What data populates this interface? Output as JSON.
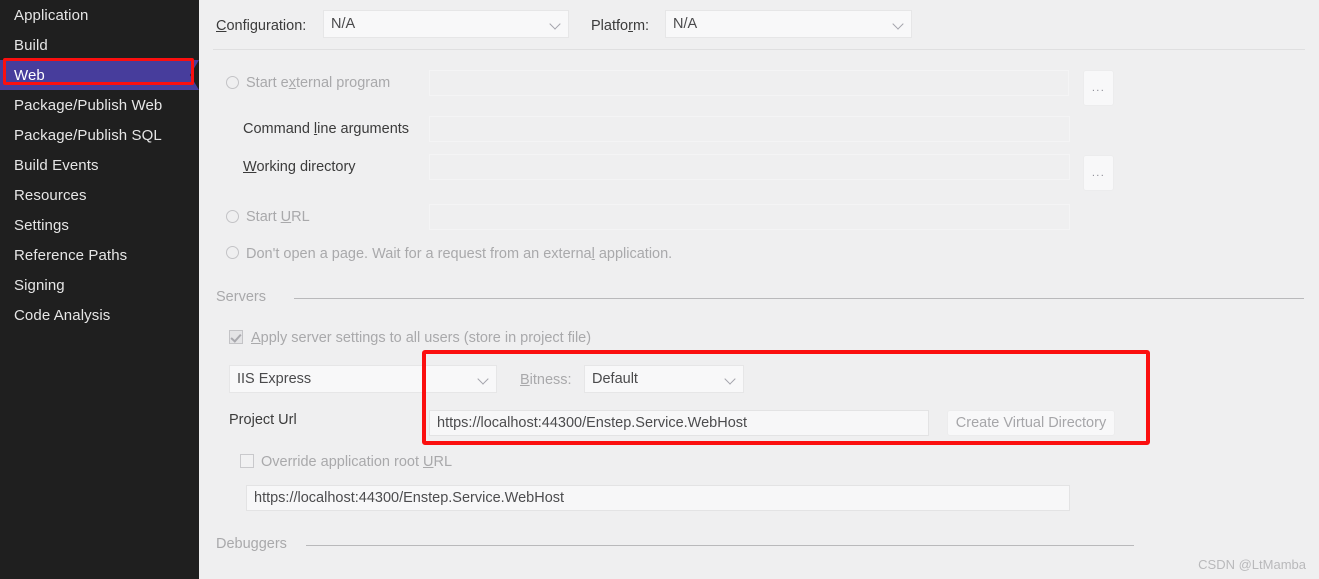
{
  "sidebar": {
    "items": [
      {
        "label": "Application",
        "selected": false
      },
      {
        "label": "Build",
        "selected": false
      },
      {
        "label": "Web",
        "selected": true
      },
      {
        "label": "Package/Publish Web",
        "selected": false
      },
      {
        "label": "Package/Publish SQL",
        "selected": false
      },
      {
        "label": "Build Events",
        "selected": false
      },
      {
        "label": "Resources",
        "selected": false
      },
      {
        "label": "Settings",
        "selected": false
      },
      {
        "label": "Reference Paths",
        "selected": false
      },
      {
        "label": "Signing",
        "selected": false
      },
      {
        "label": "Code Analysis",
        "selected": false
      }
    ]
  },
  "toolbar": {
    "configuration_label": "Configuration:",
    "configuration_value": "N/A",
    "platform_label": "Platform:",
    "platform_value": "N/A"
  },
  "start_action": {
    "start_external_program_label": "Start external program",
    "start_external_program_value": "",
    "command_line_arguments_label": "Command line arguments",
    "command_line_arguments_value": "",
    "working_directory_label": "Working directory",
    "working_directory_value": "",
    "start_url_label": "Start URL",
    "start_url_value": "",
    "dont_open_page_label": "Don't open a page. Wait for a request from an external application.",
    "browse_button_label": "..."
  },
  "servers": {
    "group_title": "Servers",
    "apply_server_settings_label": "Apply server settings to all users (store in project file)",
    "apply_server_settings_checked": true,
    "server_value": "IIS Express",
    "bitness_label": "Bitness:",
    "bitness_value": "Default",
    "project_url_label": "Project Url",
    "project_url_value": "https://localhost:44300/Enstep.Service.WebHost",
    "create_virtual_directory_label": "Create Virtual Directory",
    "override_root_url_label": "Override application root URL",
    "override_root_url_checked": false,
    "override_root_url_value": "https://localhost:44300/Enstep.Service.WebHost"
  },
  "debuggers": {
    "group_title": "Debuggers"
  },
  "watermark": "CSDN @LtMamba",
  "colors": {
    "sidebar_bg": "#1f1f1f",
    "selection": "#473d9c",
    "annotation": "#fb0f0f",
    "panel_bg": "#efeff0"
  }
}
